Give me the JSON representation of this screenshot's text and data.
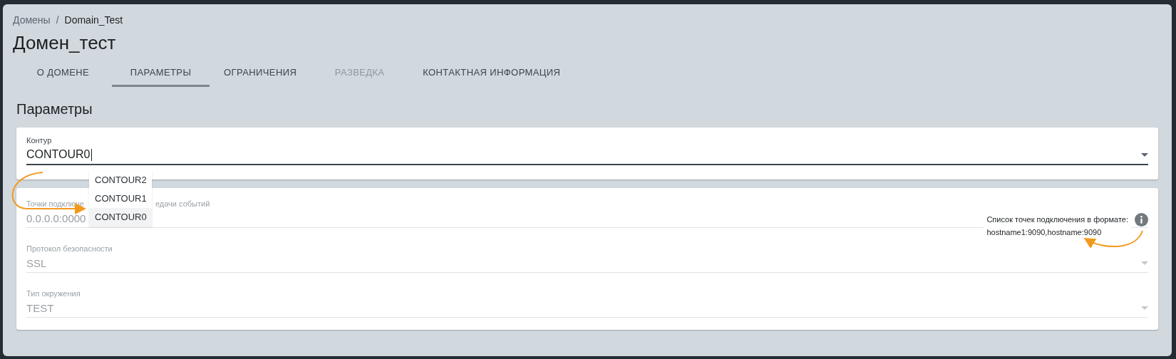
{
  "breadcrumb": {
    "separator": "/",
    "items": [
      {
        "label": "Домены",
        "current": false
      },
      {
        "label": "Domain_Test",
        "current": true
      }
    ]
  },
  "title": "Домен_тест",
  "tabs": [
    {
      "label": "О ДОМЕНЕ",
      "selected": false,
      "disabled": false
    },
    {
      "label": "ПАРАМЕТРЫ",
      "selected": true,
      "disabled": false
    },
    {
      "label": "ОГРАНИЧЕНИЯ",
      "selected": false,
      "disabled": false
    },
    {
      "label": "РАЗВЕДКА",
      "selected": false,
      "disabled": true
    },
    {
      "label": "КОНТАКТНАЯ ИНФОРМАЦИЯ",
      "selected": false,
      "disabled": false
    }
  ],
  "section_title": "Параметры",
  "contour_field": {
    "label": "Контур",
    "value": "CONTOUR0"
  },
  "contour_menu": [
    {
      "label": "CONTOUR2",
      "selected": false
    },
    {
      "label": "CONTOUR1",
      "selected": false
    },
    {
      "label": "CONTOUR0",
      "selected": true
    }
  ],
  "fields": [
    {
      "kind": "text",
      "label_parts": [
        "Точки подключе",
        "едачи событий"
      ],
      "placeholder": "0.0.0.0:0000",
      "hint_lines": [
        "Список точек подключения в формате:",
        "hostname1:9090,hostname:9090"
      ]
    },
    {
      "kind": "select",
      "label": "Протокол безопасности",
      "value": "SSL",
      "disabled": true
    },
    {
      "kind": "select",
      "label": "Тип окружения",
      "value": "TEST",
      "disabled": true
    }
  ]
}
